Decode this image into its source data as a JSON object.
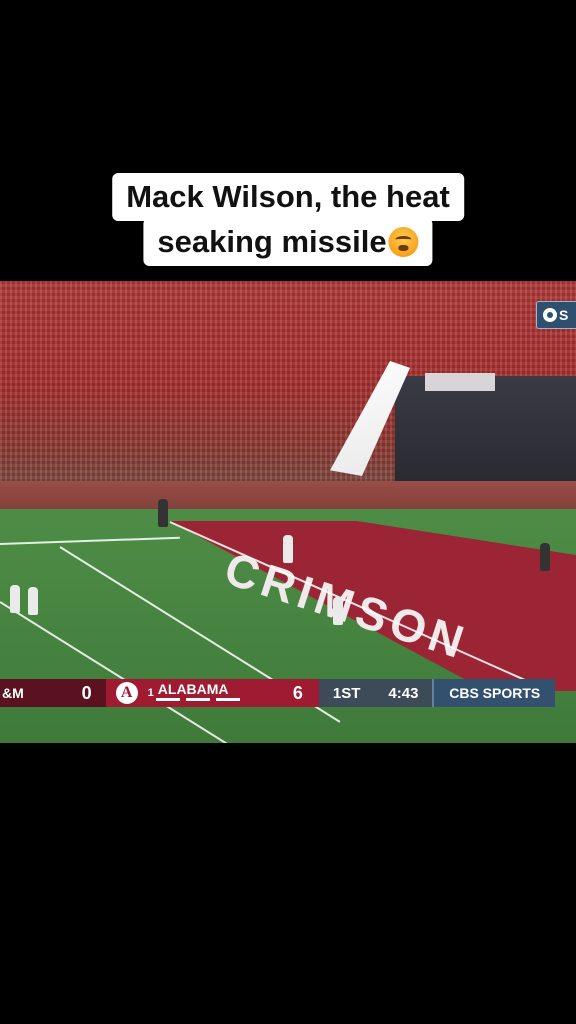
{
  "caption": {
    "line1": "Mack Wilson, the heat",
    "line2": "seaking missile"
  },
  "field": {
    "endzone_text": "CRIMSON"
  },
  "network_bug": {
    "text": "S"
  },
  "scoreboard": {
    "away_team": "&M",
    "away_score": "0",
    "home_logo": "A",
    "home_rank": "1",
    "home_team": "ALABAMA",
    "home_score": "6",
    "quarter": "1ST",
    "clock": "4:43",
    "network": "CBS SPORTS"
  },
  "colors": {
    "alabama_crimson": "#9e1b32",
    "away_maroon": "#5a1220",
    "clock_bg": "#3d4a57",
    "network_bg": "#33506e"
  }
}
